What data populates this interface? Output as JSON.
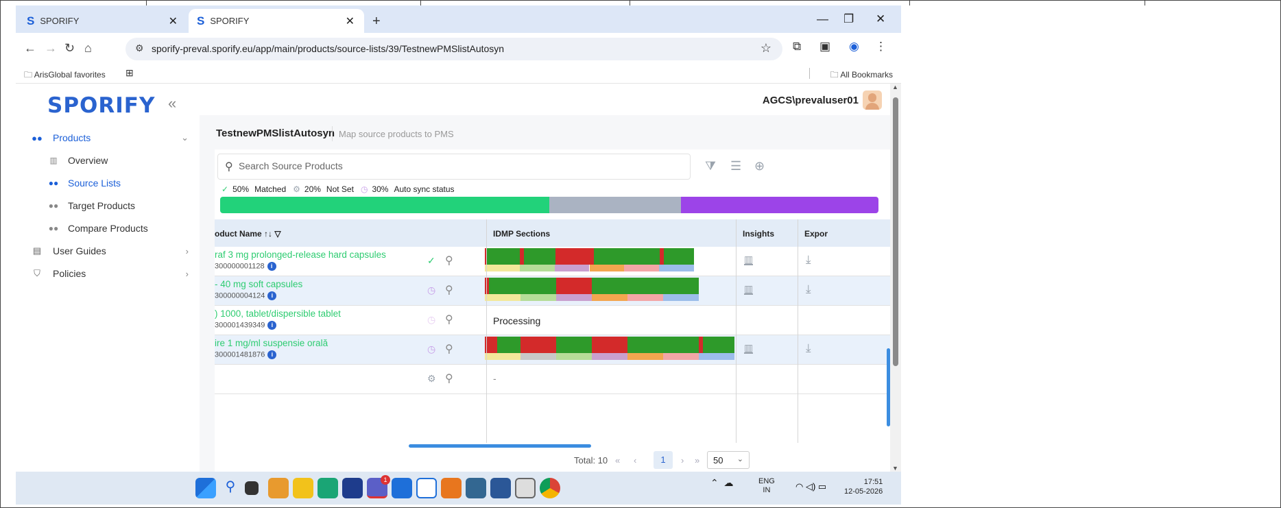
{
  "browser": {
    "tabs": [
      {
        "label": "SPORIFY",
        "logo": "S"
      },
      {
        "label": "SPORIFY",
        "logo": "S"
      }
    ],
    "url": "sporify-preval.sporify.eu/app/main/products/source-lists/39/TestnewPMSlistAutosyn",
    "bookmarks": {
      "favorites": "ArisGlobal favorites",
      "all": "All Bookmarks"
    }
  },
  "app": {
    "brand": "SPORIFY",
    "user": "AGCS\\prevaluser01",
    "sidebar": {
      "products": "Products",
      "items": [
        "Overview",
        "Source Lists",
        "Target Products",
        "Compare Products"
      ],
      "user_guides": "User Guides",
      "policies": "Policies"
    },
    "page": {
      "title": "TestnewPMSlistAutosyn",
      "subtitle": "Map source products to PMS"
    },
    "search": {
      "placeholder": "Search Source Products"
    },
    "stats": {
      "matched_pct": "50%",
      "matched_label": "Matched",
      "notset_pct": "20%",
      "notset_label": "Not Set",
      "autosync_pct": "30%",
      "autosync_label": "Auto sync status"
    },
    "progress": [
      {
        "fraction": 0.5,
        "color": "#22d27a"
      },
      {
        "fraction": 0.2,
        "color": "#aab3c2"
      },
      {
        "fraction": 0.3,
        "color": "#9c44e8"
      }
    ],
    "table": {
      "headers": {
        "name": "oduct Name",
        "idmp": "IDMP Sections",
        "insights": "Insights",
        "export": "Expor"
      },
      "processing_text": "Processing",
      "empty_text": "-",
      "rows": [
        {
          "name": "raf 3 mg prolonged-release hard capsules",
          "id": "300000001128",
          "status": "matched"
        },
        {
          "name": "- 40 mg soft capsules",
          "id": "300000004124",
          "status": "autosync"
        },
        {
          "name": ") 1000, tablet/dispersible tablet",
          "id": "300001439349",
          "status": "autosync-faded"
        },
        {
          "name": "ire 1 mg/ml suspensie orală",
          "id": "300001481876",
          "status": "autosync"
        },
        {
          "name": "",
          "id": "",
          "status": "notset"
        }
      ]
    },
    "pager": {
      "total": "Total: 10",
      "current": "1",
      "size": "50"
    }
  },
  "taskbar": {
    "lang": "ENG",
    "region": "IN",
    "time": "17:51",
    "date": "12-05-2026",
    "teams_badge": "1"
  },
  "colors": {
    "accent": "#2a63cf",
    "green": "#2ecc71",
    "idmp_green": "#2e9a2a",
    "idmp_red": "#d32a2a"
  }
}
